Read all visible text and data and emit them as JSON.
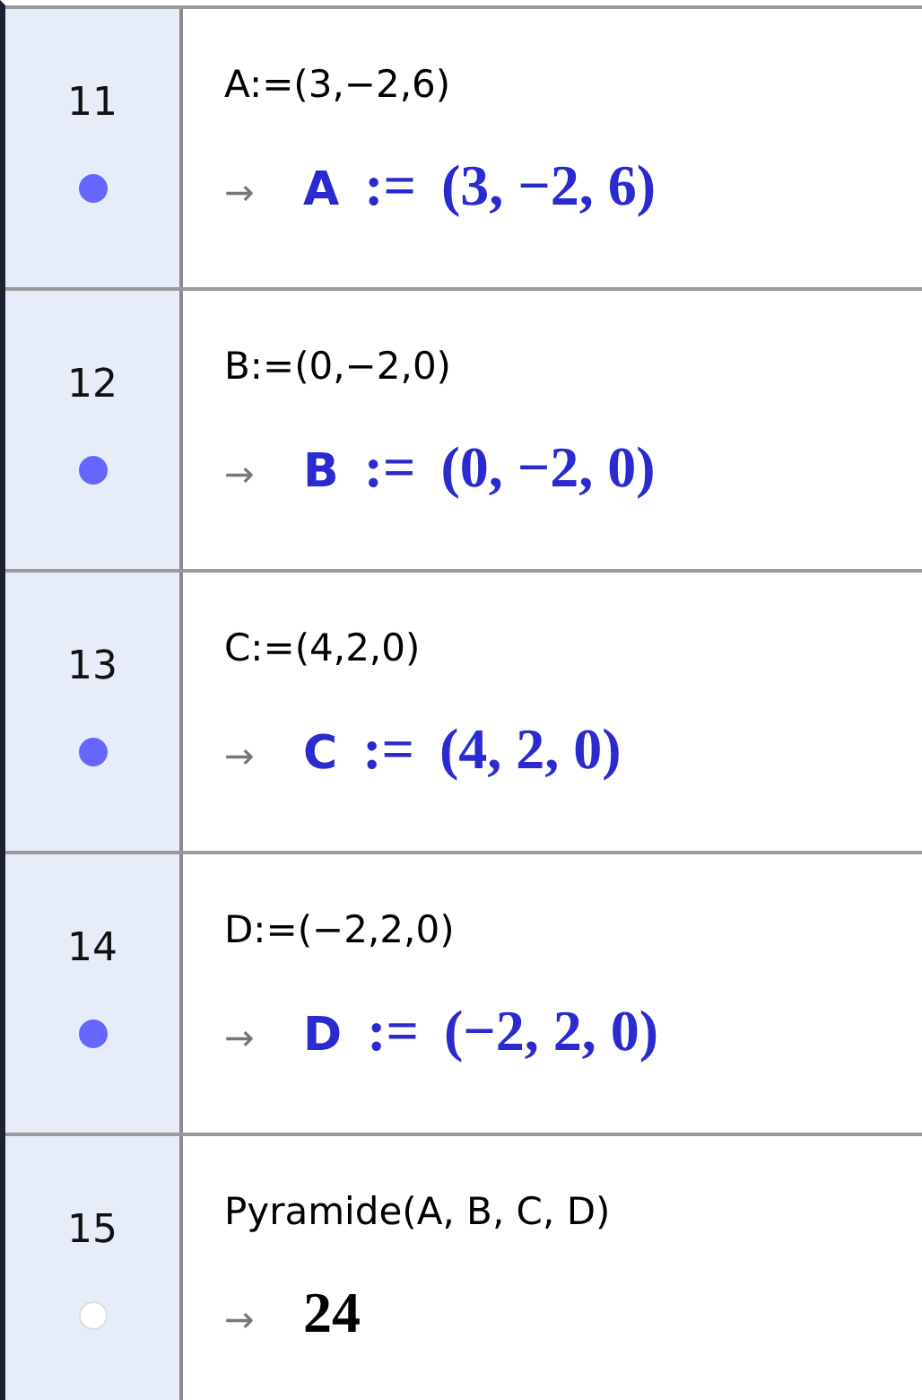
{
  "rows": [
    {
      "number": "11",
      "visible": true,
      "input": "A:=(3,−2,6)",
      "arrow": "→",
      "output": {
        "kind": "assignment",
        "name": "A",
        "operator": ":=",
        "value": "(3, −2, 6)"
      }
    },
    {
      "number": "12",
      "visible": true,
      "input": "B:=(0,−2,0)",
      "arrow": "→",
      "output": {
        "kind": "assignment",
        "name": "B",
        "operator": ":=",
        "value": "(0, −2, 0)"
      }
    },
    {
      "number": "13",
      "visible": true,
      "input": "C:=(4,2,0)",
      "arrow": "→",
      "output": {
        "kind": "assignment",
        "name": "C",
        "operator": ":=",
        "value": "(4, 2, 0)"
      }
    },
    {
      "number": "14",
      "visible": true,
      "input": "D:=(−2,2,0)",
      "arrow": "→",
      "output": {
        "kind": "assignment",
        "name": "D",
        "operator": ":=",
        "value": "(−2, 2, 0)"
      }
    },
    {
      "number": "15",
      "visible": false,
      "input": "Pyramide(A, B, C, D)",
      "arrow": "→",
      "output": {
        "kind": "number",
        "value": "24"
      }
    }
  ]
}
